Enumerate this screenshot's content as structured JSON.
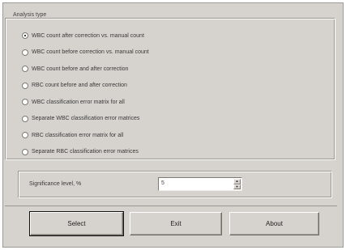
{
  "analysis_group": {
    "title": "Analysis type",
    "options": [
      {
        "label": "WBC count after correction vs. manual count",
        "checked": true
      },
      {
        "label": "WBC count before correction vs. manual count",
        "checked": false
      },
      {
        "label": "WBC count before and after correction",
        "checked": false
      },
      {
        "label": "RBC count before and after correction",
        "checked": false
      },
      {
        "label": "WBC classification error matrix for all",
        "checked": false
      },
      {
        "label": "Separate WBC classification error matrices",
        "checked": false
      },
      {
        "label": "RBC classification error matrix for all",
        "checked": false
      },
      {
        "label": "Separate RBC classification error matrices",
        "checked": false
      }
    ]
  },
  "significance": {
    "label": "Significance level, %",
    "value": "5"
  },
  "buttons": {
    "select": "Select",
    "exit": "Exit",
    "about": "About"
  }
}
